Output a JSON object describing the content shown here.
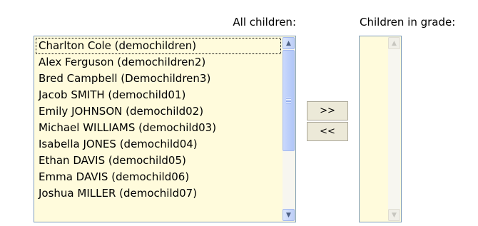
{
  "labels": {
    "all_children": "All children:",
    "children_in_grade": "Children in grade:"
  },
  "all_children": [
    "Charlton Cole (demochildren)",
    "Alex Ferguson (demochildren2)",
    "Bred Campbell (Demochildren3)",
    "Jacob SMITH (demochild01)",
    "Emily JOHNSON (demochild02)",
    "Michael WILLIAMS (demochild03)",
    "Isabella JONES (demochild04)",
    "Ethan DAVIS (demochild05)",
    "Emma DAVIS (demochild06)",
    "Joshua MILLER (demochild07)"
  ],
  "children_in_grade": [],
  "buttons": {
    "add": ">>",
    "remove": "<<"
  },
  "colors": {
    "list_background": "#fffbdc",
    "list_border": "#7f9db9",
    "scrollbar_accent": "#bccdf7"
  },
  "icons": {
    "scroll_up": "up-arrow-icon",
    "scroll_down": "down-arrow-icon"
  }
}
